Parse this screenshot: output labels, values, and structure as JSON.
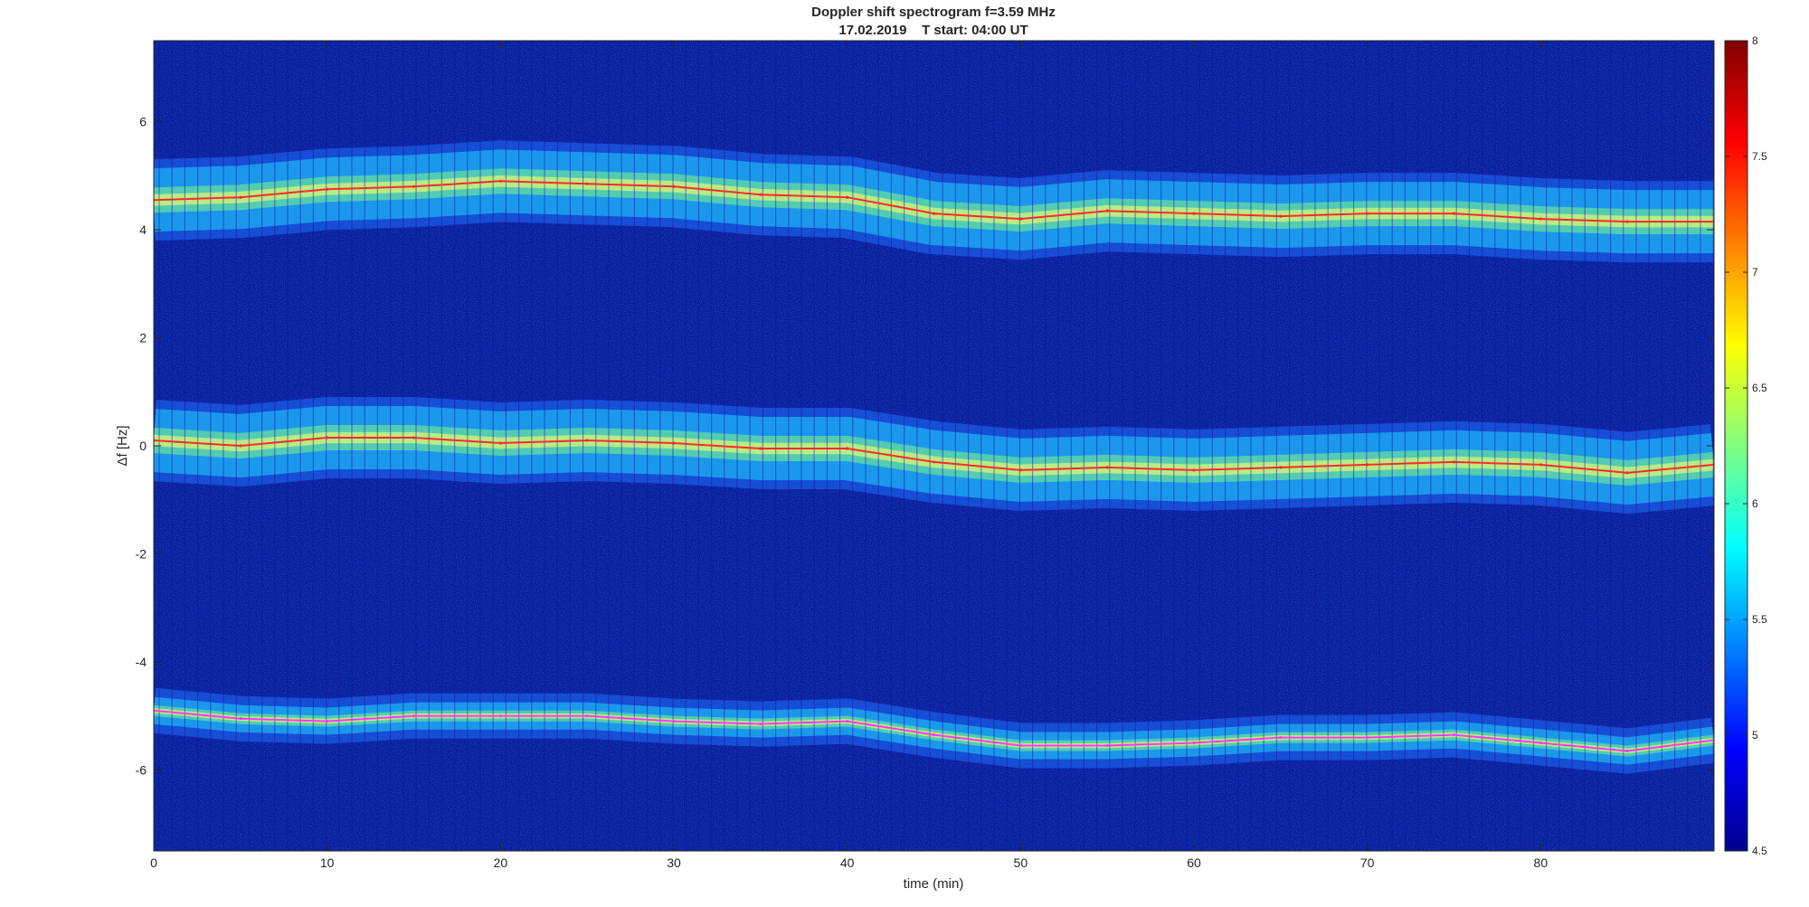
{
  "chart_data": {
    "type": "heatmap",
    "title": "Doppler shift spectrogram f=3.59 MHz",
    "subtitle": "17.02.2019    T start: 04:00 UT",
    "xlabel": "time (min)",
    "ylabel": "Δf [Hz]",
    "xlim": [
      0,
      90
    ],
    "ylim": [
      -7.5,
      7.5
    ],
    "x_ticks": [
      0,
      10,
      20,
      30,
      40,
      50,
      60,
      70,
      80
    ],
    "y_ticks": [
      -6,
      -4,
      -2,
      0,
      2,
      4,
      6
    ],
    "colormap": "jet",
    "background_color": "#0a1a9a",
    "colorbar": {
      "range": [
        4.5,
        8
      ],
      "ticks": [
        "4.5",
        "5",
        "5.5",
        "6",
        "6.5",
        "7",
        "7.5",
        "8"
      ]
    },
    "traces": [
      {
        "band": "upper",
        "color": "#ff2a2a",
        "x": [
          0,
          5,
          10,
          15,
          20,
          25,
          30,
          35,
          40,
          45,
          50,
          55,
          60,
          65,
          70,
          75,
          80,
          85,
          90
        ],
        "y": [
          4.55,
          4.6,
          4.75,
          4.8,
          4.9,
          4.85,
          4.8,
          4.65,
          4.6,
          4.3,
          4.2,
          4.35,
          4.3,
          4.25,
          4.3,
          4.3,
          4.2,
          4.15,
          4.15
        ]
      },
      {
        "band": "middle",
        "color": "#ff2a2a",
        "x": [
          0,
          5,
          10,
          15,
          20,
          25,
          30,
          35,
          40,
          45,
          50,
          55,
          60,
          65,
          70,
          75,
          80,
          85,
          90
        ],
        "y": [
          0.1,
          0.0,
          0.15,
          0.15,
          0.05,
          0.1,
          0.05,
          -0.05,
          -0.05,
          -0.3,
          -0.45,
          -0.4,
          -0.45,
          -0.4,
          -0.35,
          -0.3,
          -0.35,
          -0.5,
          -0.35
        ]
      },
      {
        "band": "lower",
        "color": "#ff3aff",
        "x": [
          0,
          5,
          10,
          15,
          20,
          25,
          30,
          35,
          40,
          45,
          50,
          55,
          60,
          65,
          70,
          75,
          80,
          85,
          90
        ],
        "y": [
          -4.9,
          -5.05,
          -5.1,
          -5.0,
          -5.0,
          -5.0,
          -5.1,
          -5.15,
          -5.1,
          -5.35,
          -5.55,
          -5.55,
          -5.5,
          -5.4,
          -5.4,
          -5.35,
          -5.5,
          -5.65,
          -5.45
        ]
      }
    ]
  }
}
